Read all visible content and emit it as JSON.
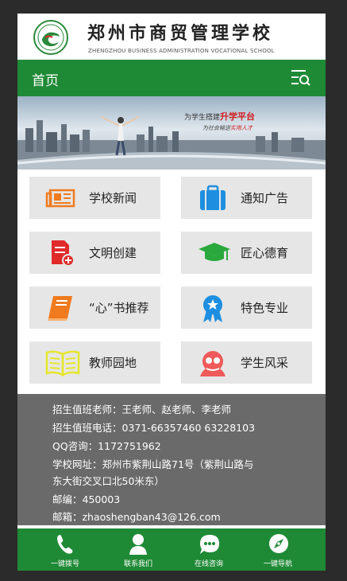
{
  "header": {
    "school_name_cn": "郑州市商贸管理学校",
    "school_name_en": "ZHENGZHOU BUSINESS ADMINISTRATION VOCATIONAL SCHOOL",
    "logo_icon": "school-logo"
  },
  "navbar": {
    "title": "首页",
    "menu_icon": "menu-search-icon"
  },
  "banner": {
    "line1_prefix": "为学生搭建",
    "line1_highlight": "升学平台",
    "line2_prefix": "为社会输送",
    "line2_highlight": "实用人才"
  },
  "tiles": [
    {
      "label": "学校新闻",
      "icon": "newspaper-icon",
      "color": "#f07a1e"
    },
    {
      "label": "通知广告",
      "icon": "briefcase-icon",
      "color": "#1e8fe0"
    },
    {
      "label": "文明创建",
      "icon": "document-add-icon",
      "color": "#e02a2a"
    },
    {
      "label": "匠心德育",
      "icon": "graduation-cap-icon",
      "color": "#2aa83c"
    },
    {
      "label": "“心”书推荐",
      "icon": "book-icon",
      "color": "#f07a1e"
    },
    {
      "label": "特色专业",
      "icon": "award-badge-icon",
      "color": "#1e8fe0"
    },
    {
      "label": "教师园地",
      "icon": "open-book-icon",
      "color": "#e6e62a"
    },
    {
      "label": "学生风采",
      "icon": "students-icon",
      "color": "#f05a5a"
    }
  ],
  "info": {
    "teachers": "招生值班老师：王老师、赵老师、李老师",
    "phone": "招生值班电话：0371-66357460 63228103",
    "qq": "QQ咨询：1172751962",
    "address_1": "学校网址：郑州市紫荆山路71号（紫荆山路与",
    "address_2": "东大街交叉口北50米东）",
    "postcode": "邮编：450003",
    "email": "邮箱：zhaoshengban43@126.com"
  },
  "bottom_nav": [
    {
      "label": "一键拨号",
      "icon": "phone-icon"
    },
    {
      "label": "联系我们",
      "icon": "person-icon"
    },
    {
      "label": "在线咨询",
      "icon": "chat-icon"
    },
    {
      "label": "一键导航",
      "icon": "compass-icon"
    }
  ],
  "colors": {
    "brand_green": "#1f8a36",
    "tile_bg": "#e6e6e6",
    "info_bg": "#6a6a6a"
  }
}
